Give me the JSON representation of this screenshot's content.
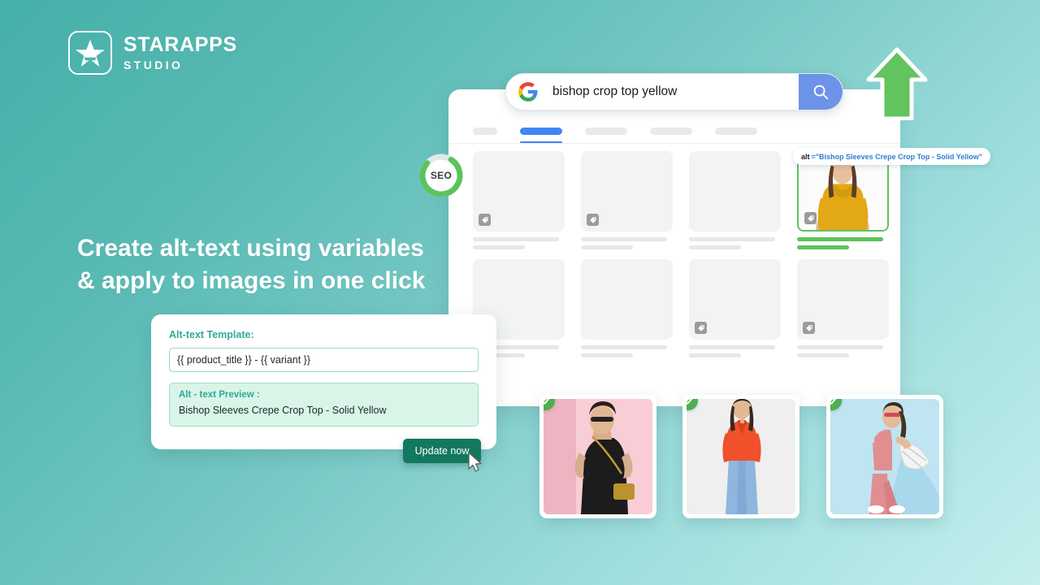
{
  "brand": {
    "name": "STARAPPS",
    "sub": "STUDIO",
    "logo_icon": "star-in-rounded-square-icon"
  },
  "headline": {
    "line1": "Create alt-text using variables",
    "line2": "& apply to images in one click"
  },
  "search": {
    "engine_icon": "google-g-icon",
    "query": "bishop crop top yellow",
    "button_icon": "magnifier-icon",
    "button_color": "#6d93e8"
  },
  "browser": {
    "tabs": [
      {
        "name": "tab-pill-1",
        "active": false,
        "width": "small"
      },
      {
        "name": "tab-pill-2",
        "active": true,
        "width": "wide"
      },
      {
        "name": "tab-pill-3",
        "active": false,
        "width": "wide"
      },
      {
        "name": "tab-pill-4",
        "active": false,
        "width": "wide"
      },
      {
        "name": "tab-pill-5",
        "active": false,
        "width": "wide"
      }
    ],
    "active_tab_color": "#4285f4",
    "placeholder_color": "#f2f3f4",
    "results_row1": [
      {
        "name": "result-placeholder-1",
        "has_tag_icon": true,
        "highlighted": false
      },
      {
        "name": "result-placeholder-2",
        "has_tag_icon": true,
        "highlighted": false
      },
      {
        "name": "result-placeholder-3",
        "has_tag_icon": false,
        "highlighted": false
      },
      {
        "name": "result-highlighted-product",
        "has_tag_icon": true,
        "highlighted": true
      }
    ],
    "results_row2": [
      {
        "name": "result-placeholder-5",
        "has_tag_icon": false,
        "highlighted": false
      },
      {
        "name": "result-placeholder-6",
        "has_tag_icon": false,
        "highlighted": false
      },
      {
        "name": "result-placeholder-7",
        "has_tag_icon": true,
        "highlighted": false
      },
      {
        "name": "result-placeholder-8",
        "has_tag_icon": true,
        "highlighted": false
      }
    ],
    "highlight_color": "#5cc35c"
  },
  "tooltip": {
    "key": "alt",
    "equals": " = ",
    "value": "\"Bishop Sleeves Crepe Crop Top - Solid Yellow\""
  },
  "seo_badge": {
    "label": "SEO",
    "progress": 78,
    "ring_color": "#5cc35c",
    "track_color": "#e3e6e8"
  },
  "arrow": {
    "icon": "up-arrow-icon",
    "color": "#62c45e"
  },
  "alt_card": {
    "template_label": "Alt-text Template:",
    "template_value": "{{ product_title }} - {{ variant }}",
    "preview_label": "Alt - text Preview :",
    "preview_value": "Bishop Sleeves Crepe Crop Top - Solid Yellow",
    "accent_color": "#2fa89a",
    "preview_bg": "#d8f5e8"
  },
  "update_button": {
    "label": "Update now",
    "color": "#12795e",
    "cursor_icon": "mouse-pointer-icon"
  },
  "product_cards": [
    {
      "name": "product-card-black-dress",
      "checked": true,
      "check_icon": "check-circle-icon"
    },
    {
      "name": "product-card-orange-shirt",
      "checked": true,
      "check_icon": "check-circle-icon"
    },
    {
      "name": "product-card-pink-outfit",
      "checked": true,
      "check_icon": "check-circle-icon"
    }
  ]
}
